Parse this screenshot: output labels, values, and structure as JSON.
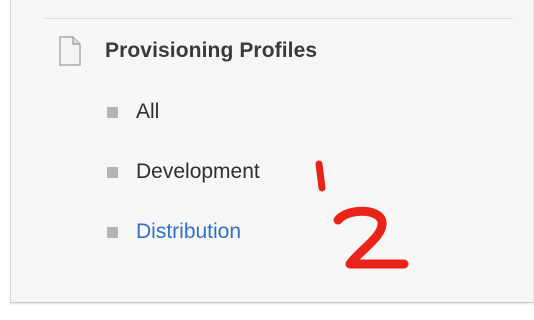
{
  "section": {
    "icon": "document-icon",
    "title": "Provisioning Profiles"
  },
  "nav": {
    "items": [
      {
        "label": "All",
        "state": "normal"
      },
      {
        "label": "Development",
        "state": "normal"
      },
      {
        "label": "Distribution",
        "state": "link"
      }
    ]
  },
  "annotations": {
    "mark_1": "1",
    "mark_2": "2",
    "color": "#e8231a"
  },
  "colors": {
    "link": "#2f73c0",
    "text": "#2f2f2f",
    "bullet": "#b4b4b4",
    "panel": "#f6f6f6"
  }
}
